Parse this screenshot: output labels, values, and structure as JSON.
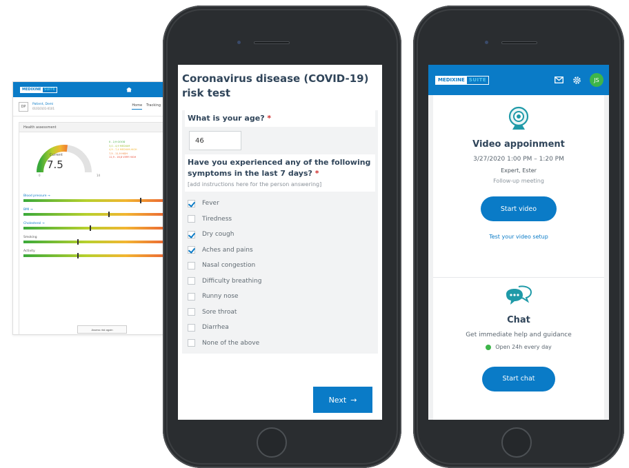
{
  "desktop": {
    "logo": {
      "part1": "MEDIXINE",
      "part2": "SUITE"
    },
    "patient": {
      "initials": "DP",
      "name": "Patient, Demi",
      "id": "01010101-0101"
    },
    "tabs": [
      {
        "label": "Home"
      },
      {
        "label": "Tracking"
      }
    ],
    "section_title": "Health assessment",
    "gauge": {
      "caption": "Current",
      "value": "7.5",
      "min": "0",
      "max": "14",
      "level_fraction": 0.54
    },
    "legend": [
      {
        "text": "0 - 2,9  GOOD",
        "color": "#3aa93a"
      },
      {
        "text": "3,0 - 4,9  MEDIUM",
        "color": "#9cbf2a"
      },
      {
        "text": "4,9 - 7,4  MEDIUM-HIGH",
        "color": "#f2b531"
      },
      {
        "text": "7,5 - 11,9  HIGH",
        "color": "#ee7d30"
      },
      {
        "text": "11,9 - 16,8  VERY HIGH",
        "color": "#e94b35"
      }
    ],
    "risk_bars": [
      {
        "label": "Blood pressure →",
        "link": true,
        "level": 0.74
      },
      {
        "label": "BMI →",
        "link": true,
        "level": 0.54
      },
      {
        "label": "Cholesterol →",
        "link": true,
        "level": 0.42
      },
      {
        "label": "Smoking",
        "link": false,
        "level": 0.34
      },
      {
        "label": "Activity",
        "link": false,
        "level": 0.34
      }
    ],
    "assess_button": "Assess risk again"
  },
  "form": {
    "title": "Coronavirus disease (COVID-19) risk test",
    "age_question": "What is your age?",
    "required_mark": "*",
    "age_value": "46",
    "symptom_question": "Have you experienced any of the following symptoms in the last 7 days?",
    "instructions": "[add instructions here for the person answering]",
    "options": [
      {
        "label": "Fever",
        "checked": true
      },
      {
        "label": "Tiredness",
        "checked": false
      },
      {
        "label": "Dry cough",
        "checked": true
      },
      {
        "label": "Aches and pains",
        "checked": true
      },
      {
        "label": "Nasal congestion",
        "checked": false
      },
      {
        "label": "Difficulty breathing",
        "checked": false
      },
      {
        "label": "Runny nose",
        "checked": false
      },
      {
        "label": "Sore throat",
        "checked": false
      },
      {
        "label": "Diarrhea",
        "checked": false
      },
      {
        "label": "None of the above",
        "checked": false
      }
    ],
    "next_label": "Next",
    "next_arrow": "→"
  },
  "app": {
    "logo": {
      "part1": "MEDIXINE",
      "part2": "SUITE"
    },
    "avatar_initials": "JS",
    "video": {
      "title": "Video appoinment",
      "datetime": "3/27/2020 1:00 PM – 1:20 PM",
      "expert": "Expert, Ester",
      "type": "Follow-up meeting",
      "start_label": "Start video",
      "test_link": "Test your video setup"
    },
    "chat": {
      "title": "Chat",
      "subtitle": "Get immediate help and guidance",
      "hours": "Open 24h every day",
      "start_label": "Start chat"
    },
    "colors": {
      "brand": "#0a7bc7",
      "online": "#3db54a",
      "heading": "#30455a",
      "required": "#d0302f"
    }
  }
}
